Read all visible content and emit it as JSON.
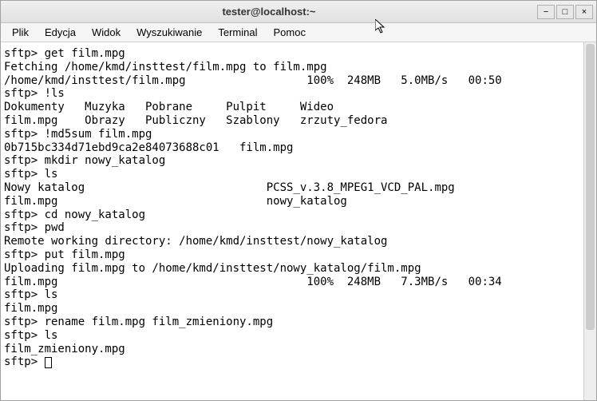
{
  "window": {
    "title": "tester@localhost:~"
  },
  "menu": {
    "file": "Plik",
    "edit": "Edycja",
    "view": "Widok",
    "search": "Wyszukiwanie",
    "terminal": "Terminal",
    "help": "Pomoc"
  },
  "terminal": {
    "lines": [
      "sftp> get film.mpg",
      "Fetching /home/kmd/insttest/film.mpg to film.mpg",
      "/home/kmd/insttest/film.mpg                  100%  248MB   5.0MB/s   00:50",
      "sftp> !ls",
      "Dokumenty   Muzyka   Pobrane     Pulpit     Wideo",
      "film.mpg    Obrazy   Publiczny   Szablony   zrzuty_fedora",
      "sftp> !md5sum film.mpg",
      "0b715bc334d71ebd9ca2e84073688c01   film.mpg",
      "sftp> mkdir nowy_katalog",
      "sftp> ls",
      "Nowy katalog                           PCSS_v.3.8_MPEG1_VCD_PAL.mpg",
      "film.mpg                               nowy_katalog",
      "sftp> cd nowy_katalog",
      "sftp> pwd",
      "Remote working directory: /home/kmd/insttest/nowy_katalog",
      "sftp> put film.mpg",
      "Uploading film.mpg to /home/kmd/insttest/nowy_katalog/film.mpg",
      "film.mpg                                     100%  248MB   7.3MB/s   00:34",
      "sftp> ls",
      "film.mpg",
      "sftp> rename film.mpg film_zmieniony.mpg",
      "sftp> ls",
      "film_zmieniony.mpg"
    ],
    "prompt": "sftp> "
  },
  "controls": {
    "minimize": "−",
    "maximize": "□",
    "close": "×"
  }
}
